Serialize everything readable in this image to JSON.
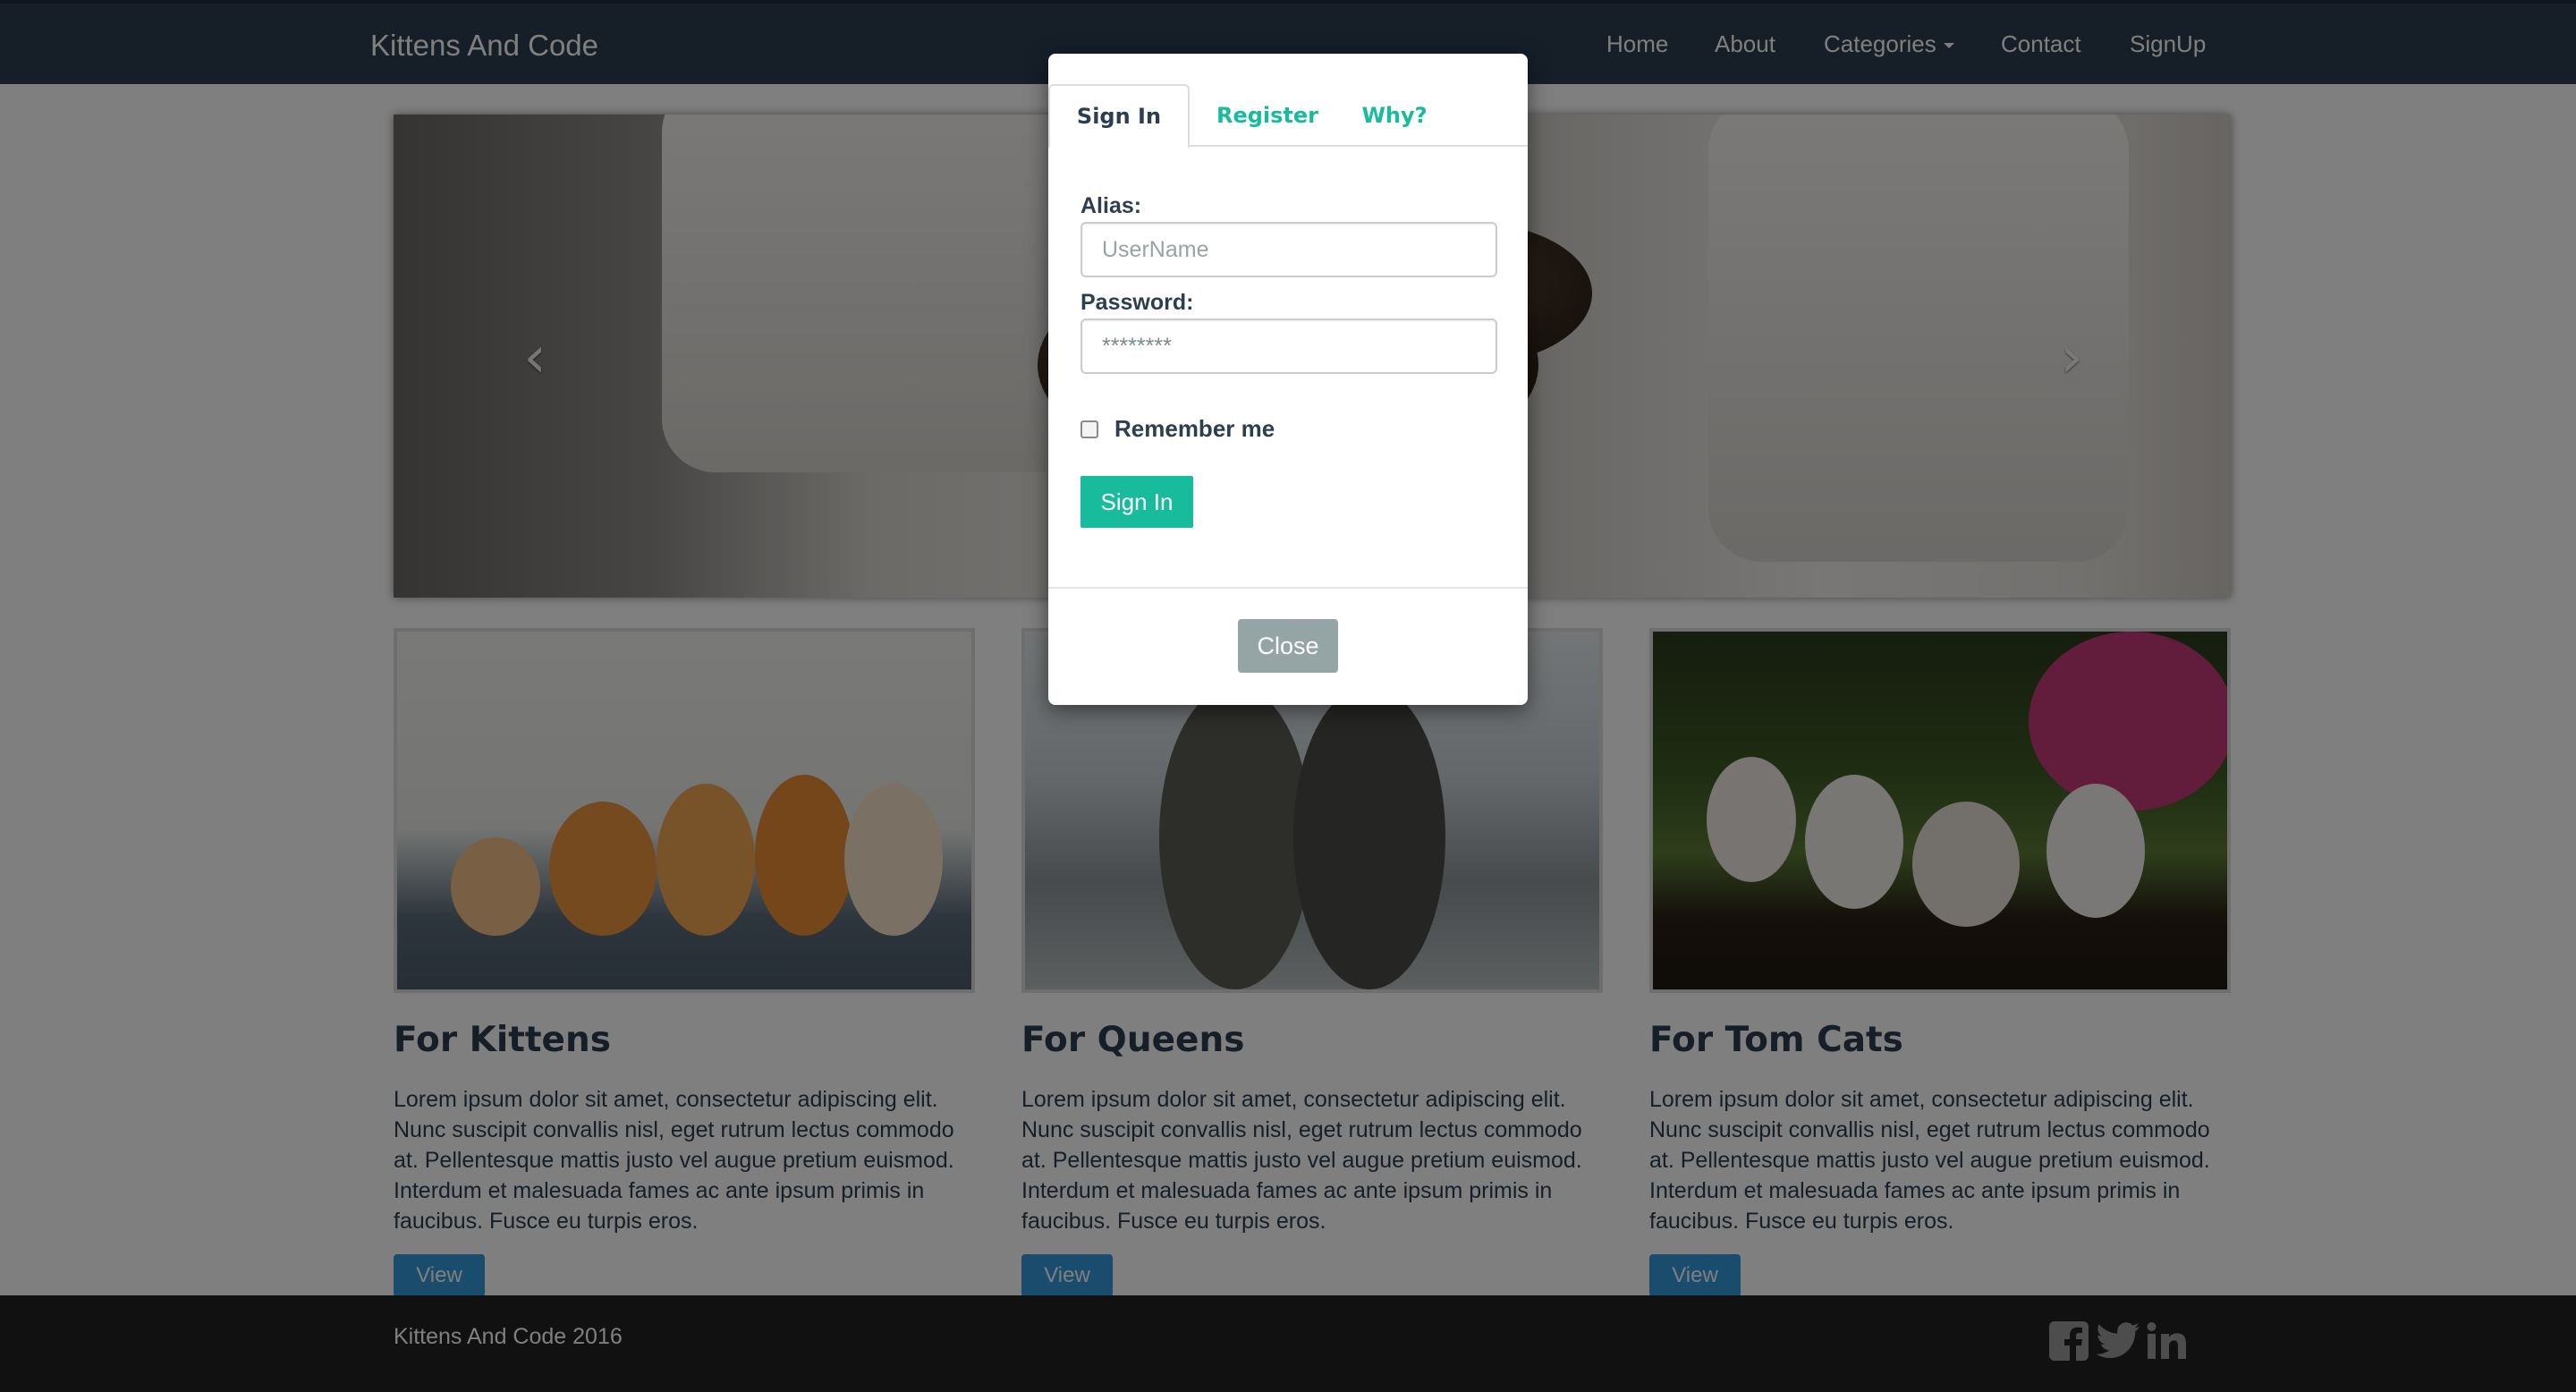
{
  "navbar": {
    "brand": "Kittens And Code",
    "links": [
      {
        "label": "Home"
      },
      {
        "label": "About"
      },
      {
        "label": "Categories"
      },
      {
        "label": "Contact"
      },
      {
        "label": "SignUp"
      }
    ]
  },
  "carousel": {
    "prev_icon": "chevron-left-icon",
    "next_icon": "chevron-right-icon",
    "prev_glyph": "‹",
    "next_glyph": "›"
  },
  "sections": [
    {
      "title": "For Kittens",
      "text": "Lorem ipsum dolor sit amet, consectetur adipiscing elit. Nunc suscipit convallis nisl, eget rutrum lectus commodo at. Pellentesque mattis justo vel augue pretium euismod. Interdum et malesuada fames ac ante ipsum primis in faucibus. Fusce eu turpis eros.",
      "button": "View"
    },
    {
      "title": "For Queens",
      "text": "Lorem ipsum dolor sit amet, consectetur adipiscing elit. Nunc suscipit convallis nisl, eget rutrum lectus commodo at. Pellentesque mattis justo vel augue pretium euismod. Interdum et malesuada fames ac ante ipsum primis in faucibus. Fusce eu turpis eros.",
      "button": "View"
    },
    {
      "title": "For Tom Cats",
      "text": "Lorem ipsum dolor sit amet, consectetur adipiscing elit. Nunc suscipit convallis nisl, eget rutrum lectus commodo at. Pellentesque mattis justo vel augue pretium euismod. Interdum et malesuada fames ac ante ipsum primis in faucibus. Fusce eu turpis eros.",
      "button": "View"
    }
  ],
  "footer": {
    "copyright": "Kittens And Code 2016",
    "social_icons": [
      "facebook-icon",
      "twitter-icon",
      "linkedin-icon"
    ]
  },
  "modal": {
    "tabs": [
      {
        "label": "Sign In",
        "active": true
      },
      {
        "label": "Register",
        "active": false
      },
      {
        "label": "Why?",
        "active": false
      }
    ],
    "alias_label": "Alias:",
    "alias_placeholder": "UserName",
    "alias_value": "",
    "password_label": "Password:",
    "password_value": "********",
    "remember_label": "Remember me",
    "remember_checked": false,
    "signin_button": "Sign In",
    "close_button": "Close"
  },
  "colors": {
    "navbar": "#2c3e50",
    "accent": "#18bc9c",
    "view_button": "#3498db",
    "close_button": "#95a5a6",
    "footer": "#222222"
  }
}
